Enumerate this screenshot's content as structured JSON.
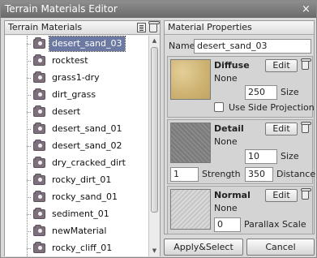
{
  "window": {
    "title": "Terrain Materials Editor",
    "close_glyph": "×"
  },
  "left_panel": {
    "header": "Terrain Materials",
    "icons": [
      "list-icon",
      "trash-icon"
    ],
    "items": [
      {
        "label": "desert_sand_03",
        "selected": true
      },
      {
        "label": "rocktest"
      },
      {
        "label": "grass1-dry"
      },
      {
        "label": "dirt_grass"
      },
      {
        "label": "desert"
      },
      {
        "label": "desert_sand_01"
      },
      {
        "label": "desert_sand_02"
      },
      {
        "label": "dry_cracked_dirt"
      },
      {
        "label": "rocky_dirt_01"
      },
      {
        "label": "rocky_sand_01"
      },
      {
        "label": "sediment_01"
      },
      {
        "label": "newMaterial"
      },
      {
        "label": "rocky_cliff_01"
      }
    ]
  },
  "properties": {
    "header": "Material Properties",
    "name_label": "Name",
    "name_value": "desert_sand_03",
    "diffuse": {
      "title": "Diffuse",
      "edit_label": "Edit",
      "texture": "None",
      "size_value": "250",
      "size_label": "Size",
      "side_projection_label": "Use Side Projection",
      "side_projection_checked": false
    },
    "detail": {
      "title": "Detail",
      "edit_label": "Edit",
      "texture": "None",
      "size_value": "10",
      "size_label": "Size",
      "strength_value": "1",
      "strength_label": "Strength",
      "distance_value": "350",
      "distance_label": "Distance"
    },
    "normal": {
      "title": "Normal",
      "edit_label": "Edit",
      "texture": "None",
      "parallax_value": "0",
      "parallax_label": "Parallax Scale"
    }
  },
  "buttons": {
    "apply": "Apply&Select",
    "cancel": "Cancel"
  }
}
